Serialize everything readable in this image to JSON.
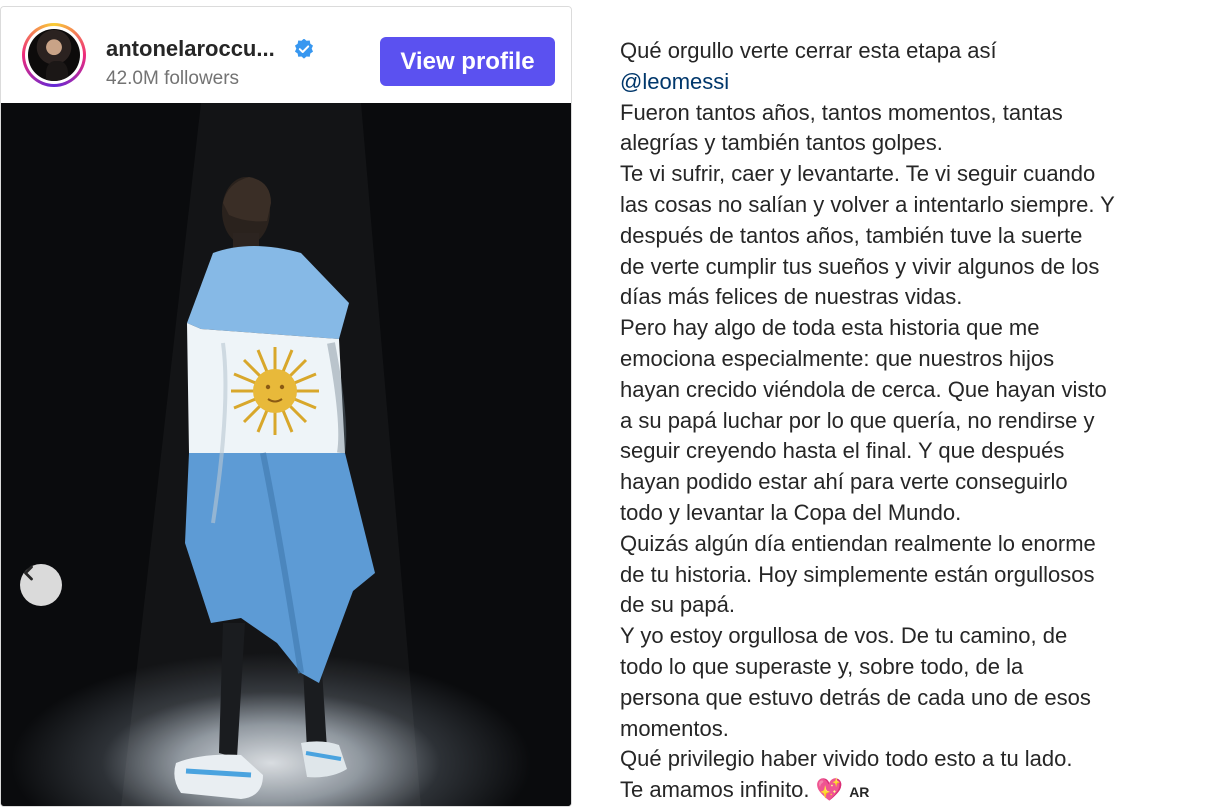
{
  "profile": {
    "username": "antonelaroccu...",
    "followers": "42.0M followers",
    "view_profile_label": "View profile",
    "verified_icon": "verified-badge-icon"
  },
  "post": {
    "image_alt": "Man wrapped in Argentina flag",
    "carousel_prev_icon": "chevron-left-icon"
  },
  "caption": {
    "lines": [
      "Qué orgullo verte cerrar esta etapa así",
      "@leomessi",
      "Fueron tantos años, tantos momentos, tantas",
      "alegrías y también tantos golpes.",
      "Te vi sufrir, caer y levantarte. Te vi seguir cuando",
      "las cosas no salían y volver a intentarlo siempre. Y",
      "después de tantos años, también tuve la suerte",
      "de verte cumplir tus sueños y vivir algunos de los",
      "días más felices de nuestras vidas.",
      "Pero hay algo de toda esta historia que me",
      "emociona especialmente: que nuestros hijos",
      "hayan crecido viéndola de cerca. Que hayan visto",
      "a su papá luchar por lo que quería, no rendirse y",
      "seguir creyendo hasta el final. Y que después",
      "hayan podido estar ahí para verte conseguirlo",
      "todo y levantar la Copa del Mundo.",
      "Quizás algún día entiendan realmente lo enorme",
      "de tu historia. Hoy simplemente están orgullosos",
      "de su papá.",
      "Y yo estoy orgullosa de vos. De tu camino, de",
      "todo lo que superaste y, sobre todo, de la",
      "persona que estuvo detrás de cada uno de esos",
      "momentos.",
      "Qué privilegio haber vivido todo esto a tu lado."
    ],
    "last_line": "Te amamos infinito.",
    "heart": "💖",
    "flag_code": "AR"
  },
  "colors": {
    "button": "#5b51f0",
    "mention": "#00376b",
    "text": "#262626",
    "muted": "#737373"
  }
}
